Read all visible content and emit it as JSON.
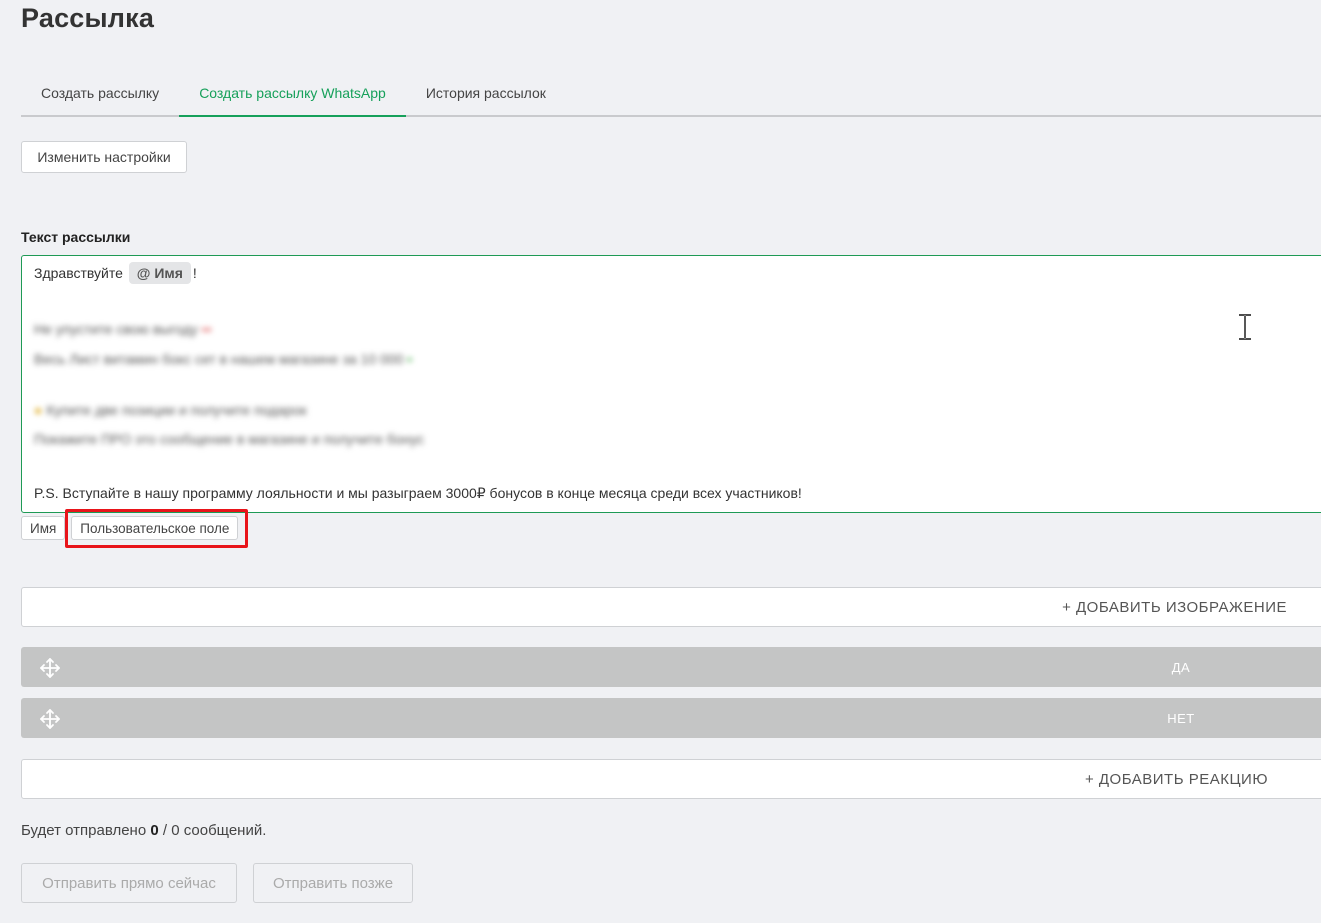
{
  "page": {
    "title": "Рассылка"
  },
  "tabs": [
    {
      "label": "Создать рассылку"
    },
    {
      "label": "Создать рассылку WhatsApp"
    },
    {
      "label": "История рассылок"
    }
  ],
  "settings_button": "Изменить настройки",
  "editor": {
    "label": "Текст рассылки",
    "greeting": "Здравствуйте",
    "mention": "@ Имя",
    "exclamation": "!",
    "blurred_lines": [
      "Не упустите свою выгоду",
      "Весь Лист витамин бокс сет в нашем магазине за 10 000",
      "Купите две позиции и получите подарок",
      "Покажите ПРО это сообщение в магазине и получите бонус"
    ],
    "ps": "P.S. Вступайте в нашу программу лояльности и мы разыграем 3000₽ бонусов в конце месяца среди всех участников!"
  },
  "chips": [
    {
      "label": "Имя"
    },
    {
      "label": "Пользовательское поле"
    }
  ],
  "add_image": "+ ДОБАВИТЬ ИЗОБРАЖЕНИЕ",
  "reactions": [
    {
      "label": "ДА"
    },
    {
      "label": "НЕТ"
    }
  ],
  "add_reaction": "+ ДОБАВИТЬ РЕАКЦИЮ",
  "summary": {
    "prefix": "Будет отправлено",
    "count": "0",
    "rest": "/ 0 сообщений."
  },
  "send_now": "Отправить прямо сейчас",
  "send_later": "Отправить позже",
  "colors": {
    "accent": "#16a05a",
    "highlight": "#e8141a",
    "reaction_bg": "#c4c5c5"
  }
}
